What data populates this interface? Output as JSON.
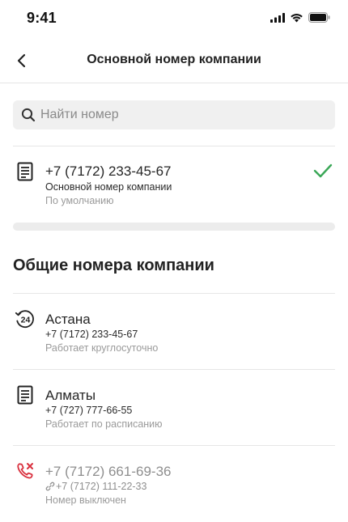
{
  "status_bar": {
    "time": "9:41"
  },
  "header": {
    "title": "Основной номер компании"
  },
  "search": {
    "placeholder": "Найти номер"
  },
  "primary": {
    "phone": "+7 (7172) 233-45-67",
    "label": "Основной номер компании",
    "note": "По умолчанию",
    "selected": true,
    "icon": "document-icon"
  },
  "section": {
    "title": "Общие номера компании"
  },
  "numbers": [
    {
      "name": "Астана",
      "phone": "+7 (7172) 233-45-67",
      "status": "Работает круглосуточно",
      "icon": "24-hours-icon"
    },
    {
      "name": "Алматы",
      "phone": "+7 (727) 777-66-55",
      "status": "Работает по расписанию",
      "icon": "document-icon"
    },
    {
      "name": "+7 (7172) 661-69-36",
      "phone": "+7 (7172) 111-22-33",
      "status": "Номер выключен",
      "icon": "phone-off-icon",
      "disabled": true
    }
  ],
  "colors": {
    "accent_green": "#3aa757",
    "danger_red": "#d9303e",
    "divider": "#e6e6e6"
  }
}
